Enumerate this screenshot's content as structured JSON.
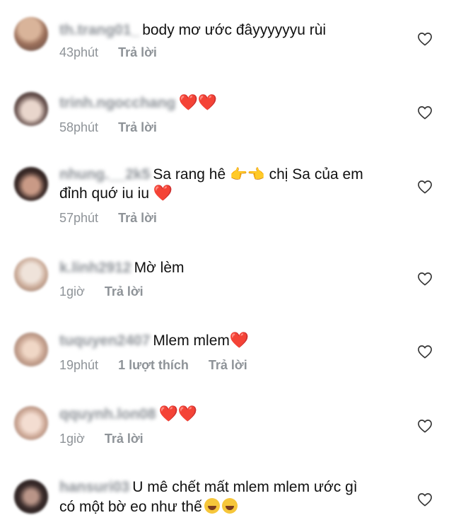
{
  "comments": [
    {
      "username": "th.trang01_",
      "text": "body mơ ước đâyyyyyyu rùi",
      "time": "43phút",
      "reply": "Trả lời"
    },
    {
      "username": "trinh.ngocchang",
      "text": "❤️❤️",
      "time": "58phút",
      "reply": "Trả lời"
    },
    {
      "username": "nhung.__2k5",
      "text": "Sa rang hê",
      "text2": "chị Sa của em",
      "line2": "đỉnh quớ iu iu",
      "time": "57phút",
      "reply": "Trả lời"
    },
    {
      "username": "k.linh2912",
      "text": "Mờ lèm",
      "time": "1giờ",
      "reply": "Trả lời"
    },
    {
      "username": "tuquyen2407",
      "text": "Mlem mlem",
      "time": "19phút",
      "likes": "1 lượt thích",
      "reply": "Trả lời"
    },
    {
      "username": "qquynh.lon08",
      "text": "❤️❤️",
      "time": "1giờ",
      "reply": "Trả lời"
    },
    {
      "username": "hansuri03",
      "text": "U mê chết mất mlem mlem ước gì",
      "line2": "có một bờ eo như thế",
      "time": "",
      "reply": ""
    }
  ],
  "icons": {
    "like": "heart-outline-icon",
    "hands": "pointing-hands-emoji",
    "laugh": "tears-of-joy-emoji"
  },
  "colors": {
    "heart": "#e0242f",
    "meta": "#8e9398"
  }
}
